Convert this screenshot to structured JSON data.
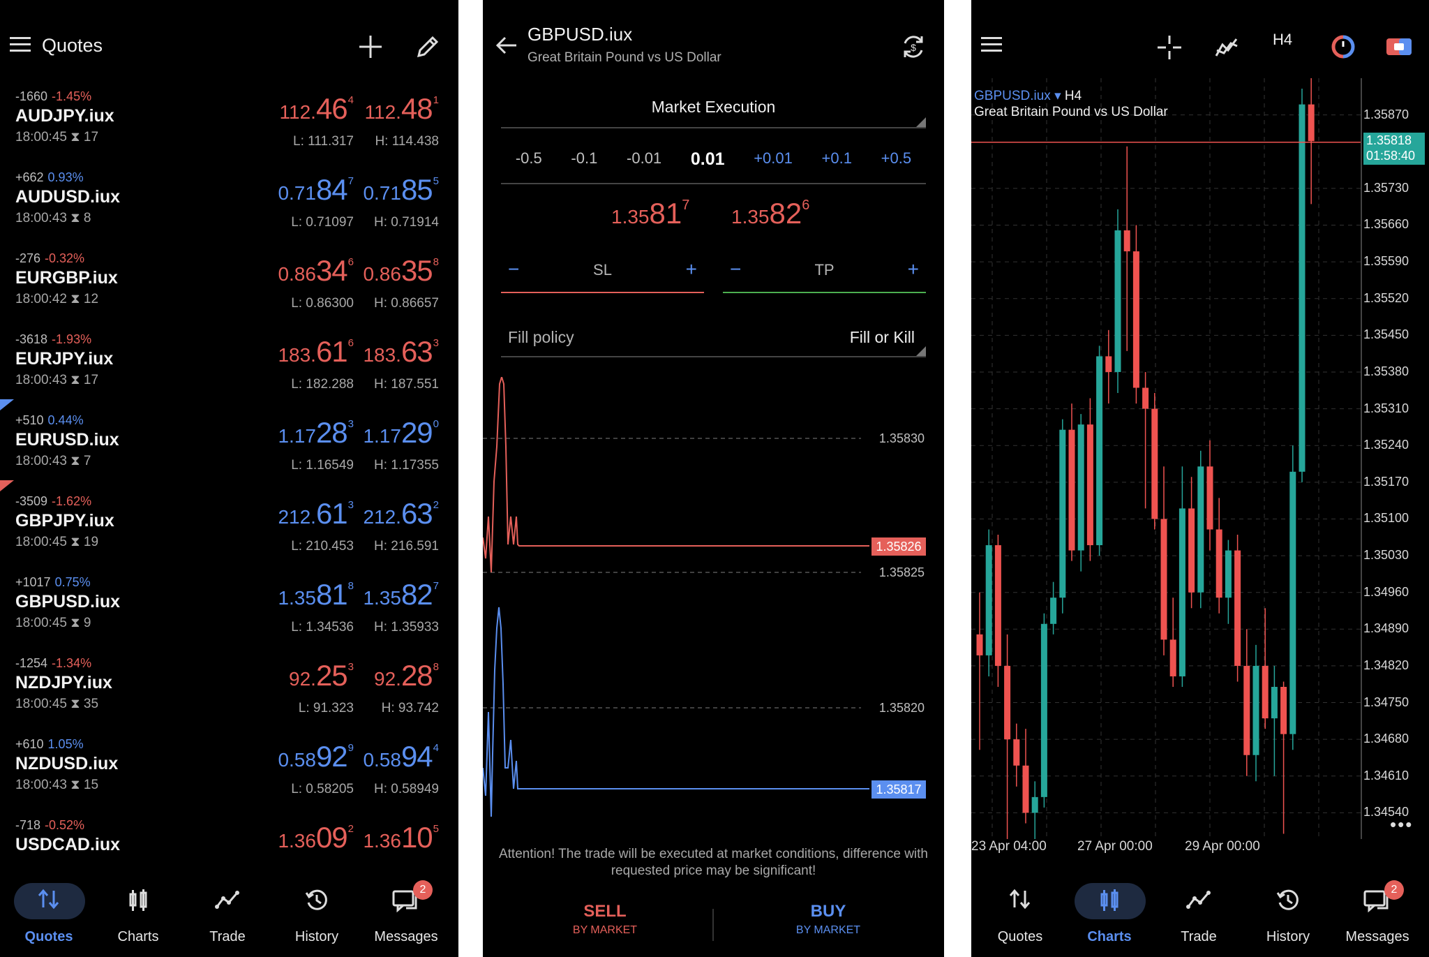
{
  "quotes_panel": {
    "title": "Quotes",
    "rows": [
      {
        "change": "-1660",
        "pct": "-1.45%",
        "symbol": "AUDJPY.iux",
        "time": "18:00:45",
        "spread": "17",
        "bid_small": "112.",
        "bid_big": "46",
        "bid_sup": "4",
        "ask_small": "112.",
        "ask_big": "48",
        "ask_sup": "1",
        "low": "L: 111.317",
        "high": "H: 114.438",
        "color": "red"
      },
      {
        "change": "+662",
        "pct": "0.93%",
        "symbol": "AUDUSD.iux",
        "time": "18:00:43",
        "spread": "8",
        "bid_small": "0.71",
        "bid_big": "84",
        "bid_sup": "7",
        "ask_small": "0.71",
        "ask_big": "85",
        "ask_sup": "5",
        "low": "L: 0.71097",
        "high": "H: 0.71914",
        "color": "blue"
      },
      {
        "change": "-276",
        "pct": "-0.32%",
        "symbol": "EURGBP.iux",
        "time": "18:00:42",
        "spread": "12",
        "bid_small": "0.86",
        "bid_big": "34",
        "bid_sup": "6",
        "ask_small": "0.86",
        "ask_big": "35",
        "ask_sup": "8",
        "low": "L: 0.86300",
        "high": "H: 0.86657",
        "color": "red"
      },
      {
        "change": "-3618",
        "pct": "-1.93%",
        "symbol": "EURJPY.iux",
        "time": "18:00:43",
        "spread": "17",
        "bid_small": "183.",
        "bid_big": "61",
        "bid_sup": "6",
        "ask_small": "183.",
        "ask_big": "63",
        "ask_sup": "3",
        "low": "L: 182.288",
        "high": "H: 187.551",
        "color": "red"
      },
      {
        "change": "+510",
        "pct": "0.44%",
        "symbol": "EURUSD.iux",
        "time": "18:00:43",
        "spread": "7",
        "bid_small": "1.17",
        "bid_big": "28",
        "bid_sup": "3",
        "ask_small": "1.17",
        "ask_big": "29",
        "ask_sup": "0",
        "low": "L: 1.16549",
        "high": "H: 1.17355",
        "color": "blue"
      },
      {
        "change": "-3509",
        "pct": "-1.62%",
        "symbol": "GBPJPY.iux",
        "time": "18:00:45",
        "spread": "19",
        "bid_small": "212.",
        "bid_big": "61",
        "bid_sup": "3",
        "ask_small": "212.",
        "ask_big": "63",
        "ask_sup": "2",
        "low": "L: 210.453",
        "high": "H: 216.591",
        "color": "blue"
      },
      {
        "change": "+1017",
        "pct": "0.75%",
        "symbol": "GBPUSD.iux",
        "time": "18:00:45",
        "spread": "9",
        "bid_small": "1.35",
        "bid_big": "81",
        "bid_sup": "8",
        "ask_small": "1.35",
        "ask_big": "82",
        "ask_sup": "7",
        "low": "L: 1.34536",
        "high": "H: 1.35933",
        "color": "blue"
      },
      {
        "change": "-1254",
        "pct": "-1.34%",
        "symbol": "NZDJPY.iux",
        "time": "18:00:45",
        "spread": "35",
        "bid_small": "92.",
        "bid_big": "25",
        "bid_sup": "3",
        "ask_small": "92.",
        "ask_big": "28",
        "ask_sup": "8",
        "low": "L: 91.323",
        "high": "H: 93.742",
        "color": "red"
      },
      {
        "change": "+610",
        "pct": "1.05%",
        "symbol": "NZDUSD.iux",
        "time": "18:00:43",
        "spread": "15",
        "bid_small": "0.58",
        "bid_big": "92",
        "bid_sup": "9",
        "ask_small": "0.58",
        "ask_big": "94",
        "ask_sup": "4",
        "low": "L: 0.58205",
        "high": "H: 0.58949",
        "color": "blue"
      },
      {
        "change": "-718",
        "pct": "-0.52%",
        "symbol": "USDCAD.iux",
        "time": "",
        "spread": "",
        "bid_small": "1.36",
        "bid_big": "09",
        "bid_sup": "2",
        "ask_small": "1.36",
        "ask_big": "10",
        "ask_sup": "5",
        "low": "",
        "high": "",
        "color": "red"
      }
    ]
  },
  "nav": {
    "quotes": "Quotes",
    "charts": "Charts",
    "trade": "Trade",
    "history": "History",
    "messages": "Messages",
    "messages_badge": "2"
  },
  "order_panel": {
    "symbol": "GBPUSD.iux",
    "description": "Great Britain Pound vs US Dollar",
    "mode": "Market Execution",
    "steps": [
      "-0.5",
      "-0.1",
      "-0.01",
      "0.01",
      "+0.01",
      "+0.1",
      "+0.5"
    ],
    "sell_small": "1.35",
    "sell_big": "81",
    "sell_sup": "7",
    "buy_small": "1.35",
    "buy_big": "82",
    "buy_sup": "6",
    "sl_label": "SL",
    "tp_label": "TP",
    "fill_label": "Fill policy",
    "fill_value": "Fill or Kill",
    "tick_levels": [
      "1.35830",
      "1.35825",
      "1.35820"
    ],
    "ask_tag": "1.35826",
    "bid_tag": "1.35817",
    "attention": "Attention! The trade will be executed at market conditions, difference with requested price may be significant!",
    "sell_label": "SELL",
    "sell_sub": "BY MARKET",
    "buy_label": "BUY",
    "buy_sub": "BY MARKET",
    "colors": {
      "sell": "#e5605a",
      "buy": "#5b8ff0",
      "sl_line": "#e5605a",
      "tp_line": "#4caf50"
    }
  },
  "chart_panel": {
    "timeframe_button": "H4",
    "legend_symbol": "GBPUSD.iux",
    "legend_tf": "H4",
    "legend_desc": "Great Britain Pound vs US Dollar",
    "current_price": "1.35818",
    "countdown": "01:58:40",
    "colors": {
      "bull": "#26a69a",
      "bear": "#ef5350",
      "price_line": "#ef5350"
    }
  },
  "chart_data": {
    "type": "candlestick",
    "y_ticks": [
      "1.35870",
      "1.35730",
      "1.35660",
      "1.35590",
      "1.35520",
      "1.35450",
      "1.35380",
      "1.35310",
      "1.35240",
      "1.35170",
      "1.35100",
      "1.35030",
      "1.34960",
      "1.34890",
      "1.34820",
      "1.34750",
      "1.34680",
      "1.34610",
      "1.34540"
    ],
    "x_ticks": [
      "23 Apr 04:00",
      "27 Apr 00:00",
      "29 Apr 00:00"
    ],
    "ylim": [
      1.3449,
      1.3594
    ],
    "candles": [
      [
        1.3488,
        1.3496,
        1.3466,
        1.3484
      ],
      [
        1.3484,
        1.3508,
        1.348,
        1.3505
      ],
      [
        1.3505,
        1.3507,
        1.3478,
        1.3482
      ],
      [
        1.3482,
        1.3488,
        1.3446,
        1.3468
      ],
      [
        1.3468,
        1.3471,
        1.3459,
        1.3463
      ],
      [
        1.3463,
        1.347,
        1.3452,
        1.3454
      ],
      [
        1.3454,
        1.346,
        1.3447,
        1.3457
      ],
      [
        1.3457,
        1.3492,
        1.3455,
        1.349
      ],
      [
        1.349,
        1.3498,
        1.3488,
        1.3495
      ],
      [
        1.3495,
        1.3529,
        1.3492,
        1.3527
      ],
      [
        1.3527,
        1.3532,
        1.3502,
        1.3504
      ],
      [
        1.3504,
        1.353,
        1.35,
        1.3528
      ],
      [
        1.3528,
        1.3533,
        1.3502,
        1.3505
      ],
      [
        1.3505,
        1.3543,
        1.3503,
        1.3541
      ],
      [
        1.3541,
        1.3546,
        1.3532,
        1.3538
      ],
      [
        1.3538,
        1.3569,
        1.3534,
        1.3565
      ],
      [
        1.3565,
        1.3581,
        1.3542,
        1.3561
      ],
      [
        1.3561,
        1.3566,
        1.3532,
        1.3535
      ],
      [
        1.3535,
        1.3538,
        1.3512,
        1.3531
      ],
      [
        1.3531,
        1.3534,
        1.3508,
        1.351
      ],
      [
        1.351,
        1.352,
        1.3484,
        1.3487
      ],
      [
        1.3487,
        1.3495,
        1.3478,
        1.348
      ],
      [
        1.348,
        1.352,
        1.3478,
        1.3512
      ],
      [
        1.3512,
        1.3518,
        1.3493,
        1.3496
      ],
      [
        1.3496,
        1.3523,
        1.3493,
        1.352
      ],
      [
        1.352,
        1.3525,
        1.3504,
        1.3508
      ],
      [
        1.3508,
        1.3514,
        1.3492,
        1.3495
      ],
      [
        1.3495,
        1.3506,
        1.349,
        1.3504
      ],
      [
        1.3504,
        1.3507,
        1.3479,
        1.3482
      ],
      [
        1.3482,
        1.3489,
        1.3461,
        1.3465
      ],
      [
        1.3465,
        1.3486,
        1.346,
        1.3482
      ],
      [
        1.3482,
        1.3493,
        1.347,
        1.3472
      ],
      [
        1.3472,
        1.3482,
        1.3461,
        1.3478
      ],
      [
        1.3478,
        1.3479,
        1.345,
        1.3469
      ],
      [
        1.3469,
        1.3524,
        1.3466,
        1.3519
      ],
      [
        1.3519,
        1.3592,
        1.3517,
        1.3589
      ],
      [
        1.3589,
        1.3594,
        1.357,
        1.3582
      ]
    ]
  }
}
